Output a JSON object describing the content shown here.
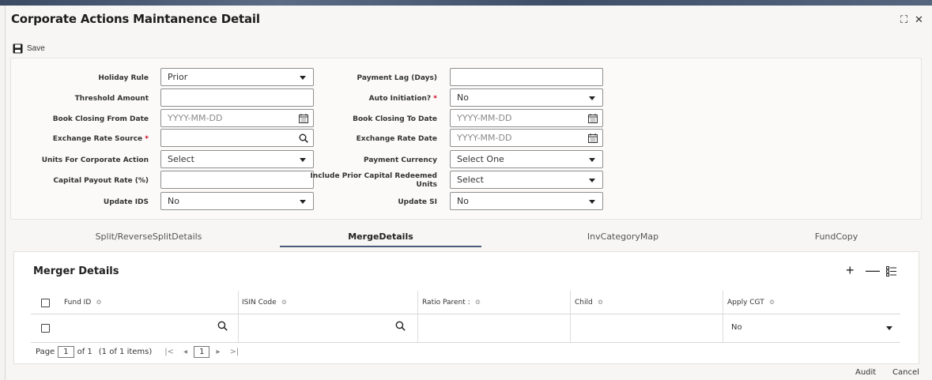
{
  "window": {
    "title": "Corporate Actions Maintanence Detail",
    "maximize_glyph": "⛶",
    "close_glyph": "✕"
  },
  "toolbar": {
    "save_label": "Save"
  },
  "form": {
    "holiday_rule": {
      "label": "Holiday Rule",
      "value": "Prior"
    },
    "payment_lag": {
      "label": "Payment Lag (Days)",
      "value": ""
    },
    "threshold_amount": {
      "label": "Threshold Amount",
      "value": ""
    },
    "auto_initiation": {
      "label": "Auto Initiation?",
      "required": "*",
      "value": "No"
    },
    "book_closing_from": {
      "label": "Book Closing From Date",
      "placeholder": "YYYY-MM-DD"
    },
    "book_closing_to": {
      "label": "Book Closing To Date",
      "placeholder": "YYYY-MM-DD"
    },
    "exchange_rate_source": {
      "label": "Exchange Rate Source",
      "required": "*",
      "value": ""
    },
    "exchange_rate_date": {
      "label": "Exchange Rate Date",
      "placeholder": "YYYY-MM-DD"
    },
    "units_for_ca": {
      "label": "Units For Corporate Action",
      "value": "Select"
    },
    "payment_currency": {
      "label": "Payment Currency",
      "value": "Select One"
    },
    "capital_payout_rate": {
      "label": "Capital Payout Rate (%)",
      "value": ""
    },
    "include_prior_capital": {
      "label_line1": "Include Prior Capital Redeemed",
      "label_line2": "Units",
      "value": "Select"
    },
    "update_ids": {
      "label": "Update IDS",
      "value": "No"
    },
    "update_si": {
      "label": "Update SI",
      "value": "No"
    }
  },
  "tabs": [
    {
      "label": "Split/ReverseSplitDetails"
    },
    {
      "label": "MergeDetails",
      "active": true
    },
    {
      "label": "InvCategoryMap"
    },
    {
      "label": "FundCopy"
    }
  ],
  "merger": {
    "title": "Merger Details",
    "columns": [
      "Fund ID",
      "ISIN Code",
      "Ratio Parent :",
      "Child",
      "Apply CGT"
    ],
    "row": {
      "apply_cgt": "No"
    },
    "pager": {
      "page_label": "Page",
      "page": "1",
      "of_label": "of 1",
      "items": "(1 of 1 items)",
      "first": "|<",
      "prev": "◂",
      "current": "1",
      "next": "▸",
      "last": ">|"
    }
  },
  "footer": {
    "audit_label": "Audit",
    "cancel_label": "Cancel"
  },
  "icons": {
    "calendar": "calendar-icon",
    "search": "search-icon",
    "add": "add-icon",
    "remove": "remove-icon",
    "list": "list-view-icon"
  }
}
